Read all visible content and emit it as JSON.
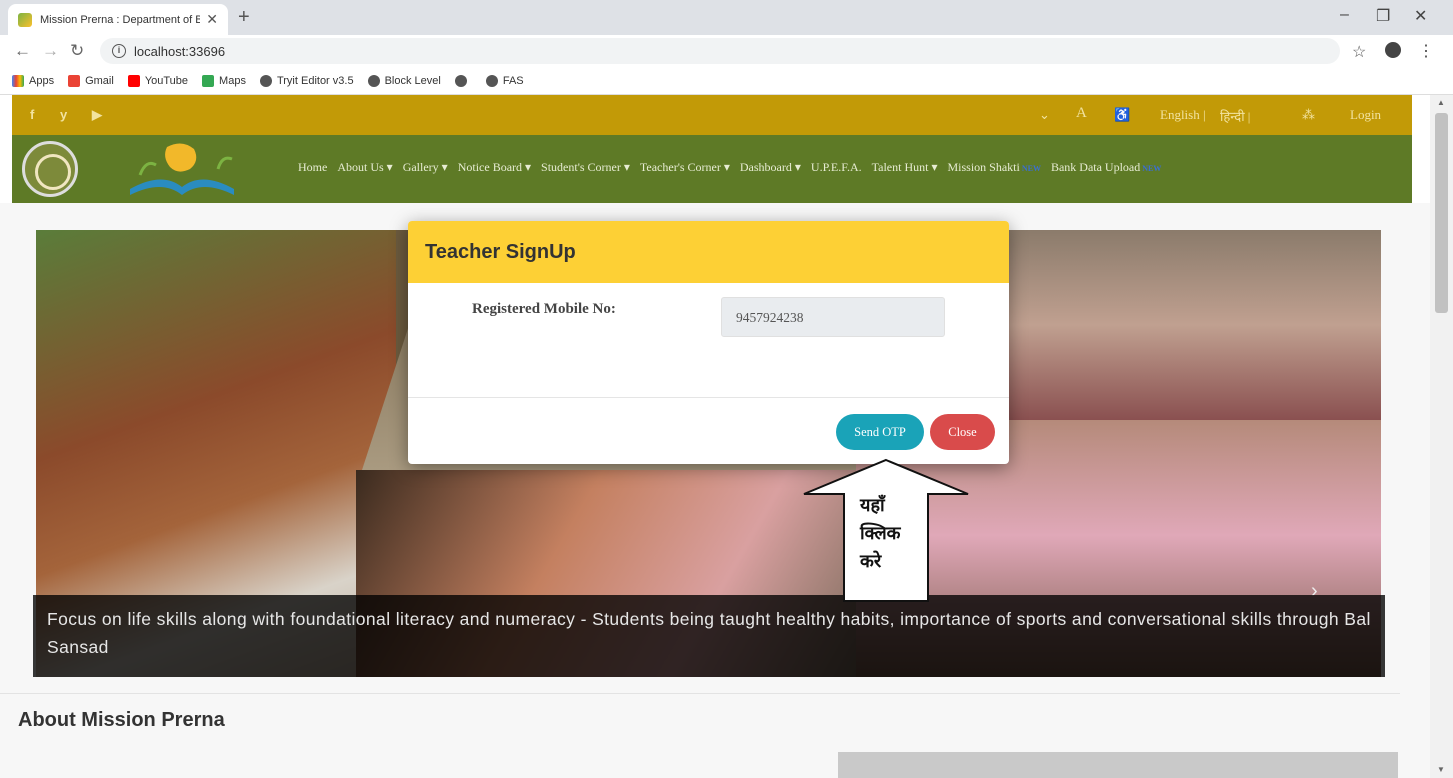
{
  "browser": {
    "tab_title": "Mission Prerna : Department of Basic Education",
    "url": "localhost:33696",
    "bookmarks": [
      "Apps",
      "Gmail",
      "YouTube",
      "Maps",
      "Tryit Editor v3.5",
      "Block Level",
      "",
      "FAS"
    ]
  },
  "topbar": {
    "font_a": "A",
    "accessibility": "♿",
    "english": "English |",
    "hindi": "हिन्दी |",
    "login": "Login"
  },
  "nav": {
    "items": [
      "Home",
      "About Us ▾",
      "Gallery ▾",
      "Notice Board ▾",
      "Student's Corner ▾",
      "Teacher's Corner ▾",
      "Dashboard ▾",
      "U.P.E.F.A.",
      "Talent Hunt ▾",
      "Mission Shakti",
      "Bank Data Upload"
    ],
    "new_badge": "NEW"
  },
  "carousel": {
    "caption": "Focus on life skills along with foundational literacy and numeracy - Students being taught healthy habits, importance of sports and conversational skills through Bal Sansad"
  },
  "about": {
    "title": "About Mission Prerna"
  },
  "modal": {
    "title": "Teacher SignUp",
    "label": "Registered Mobile No:",
    "mobile_value": "9457924238",
    "send_label": "Send OTP",
    "close_label": "Close"
  },
  "annotation": {
    "line1": "यहाँ",
    "line2": "क्लिक",
    "line3": "करे"
  },
  "colors": {
    "topstrip": "#c29a07",
    "navstrip": "#5e7a26",
    "modal_header": "#fdd035",
    "send_btn": "#1aa3b8",
    "close_btn": "#d94b4b"
  }
}
